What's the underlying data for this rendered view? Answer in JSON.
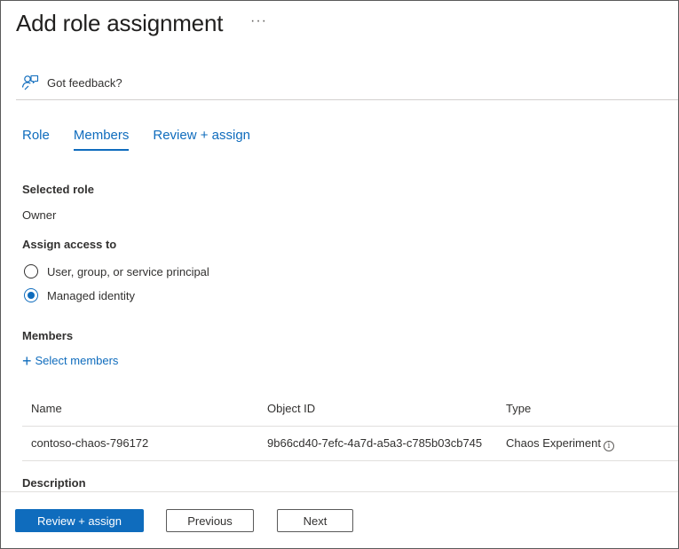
{
  "header": {
    "title": "Add role assignment",
    "more_label": "···"
  },
  "feedback": {
    "label": "Got feedback?",
    "icon": "feedback-icon"
  },
  "tabs": [
    {
      "label": "Role"
    },
    {
      "label": "Members",
      "active": true
    },
    {
      "label": "Review + assign"
    }
  ],
  "selected_role": {
    "label": "Selected role",
    "value": "Owner"
  },
  "assign_access": {
    "label": "Assign access to",
    "options": [
      {
        "label": "User, group, or service principal",
        "checked": false
      },
      {
        "label": "Managed identity",
        "checked": true
      }
    ]
  },
  "members": {
    "label": "Members",
    "select_label": "Select members",
    "columns": [
      "Name",
      "Object ID",
      "Type"
    ],
    "rows": [
      {
        "name": "contoso-chaos-796172",
        "object_id": "9b66cd40-7efc-4a7d-a5a3-c785b03cb745",
        "type": "Chaos Experiment"
      }
    ]
  },
  "description": {
    "label": "Description"
  },
  "footer": {
    "review_assign_label": "Review + assign",
    "previous_label": "Previous",
    "next_label": "Next"
  },
  "colors": {
    "accent": "#0f6cbd",
    "text": "#323130",
    "border": "#5a5a5a"
  }
}
